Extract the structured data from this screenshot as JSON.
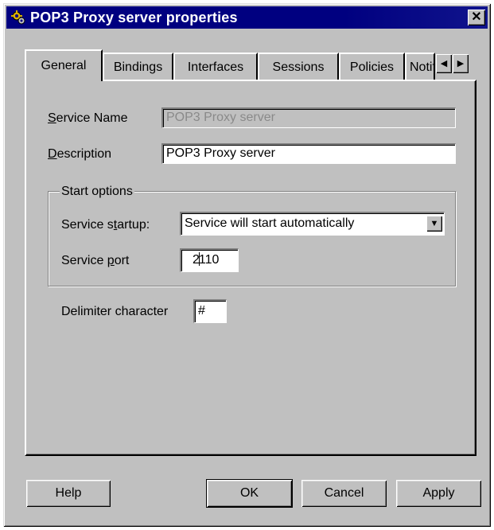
{
  "window": {
    "title": "POP3 Proxy server properties",
    "close_glyph": "✕"
  },
  "tabs": [
    {
      "label": "General",
      "active": true
    },
    {
      "label": "Bindings"
    },
    {
      "label": "Interfaces"
    },
    {
      "label": "Sessions"
    },
    {
      "label": "Policies"
    },
    {
      "label": "Notifications"
    }
  ],
  "tab_scroll": {
    "left": "◀",
    "right": "▶"
  },
  "general": {
    "service_name_label_first": "S",
    "service_name_label_rest": "ervice Name",
    "service_name_value": "POP3 Proxy server",
    "description_label_first": "D",
    "description_label_rest": "escription",
    "description_value": "POP3 Proxy server",
    "start_options_legend": "Start options",
    "service_startup_label_a": "Service s",
    "service_startup_label_b": "t",
    "service_startup_label_c": "artup:",
    "service_startup_value": "Service will start automatically",
    "service_port_label_a": "Service ",
    "service_port_label_b": "p",
    "service_port_label_c": "ort",
    "service_port_value_a": "2",
    "service_port_value_b": "110",
    "delimiter_label": "Delimiter character",
    "delimiter_value": "#"
  },
  "combo_arrow": "▼",
  "buttons": {
    "help": "Help",
    "ok": "OK",
    "cancel": "Cancel",
    "apply": "Apply"
  },
  "icons": {
    "title_icon": "gears-icon"
  }
}
